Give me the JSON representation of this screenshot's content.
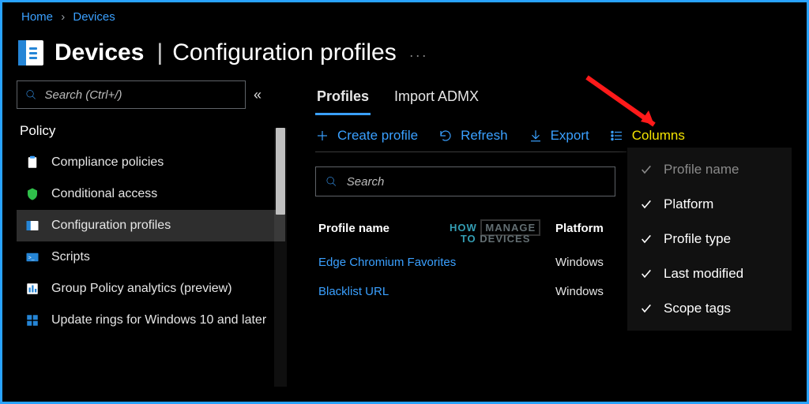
{
  "breadcrumb": {
    "home": "Home",
    "devices": "Devices"
  },
  "title": {
    "strong": "Devices",
    "rest": "Configuration profiles"
  },
  "sidebar": {
    "search_placeholder": "Search (Ctrl+/)",
    "section": "Policy",
    "items": [
      {
        "label": "Compliance policies"
      },
      {
        "label": "Conditional access"
      },
      {
        "label": "Configuration profiles"
      },
      {
        "label": "Scripts"
      },
      {
        "label": "Group Policy analytics (preview)"
      },
      {
        "label": "Update rings for Windows 10 and later"
      }
    ]
  },
  "tabs": {
    "profiles": "Profiles",
    "import": "Import ADMX"
  },
  "toolbar": {
    "create": "Create profile",
    "refresh": "Refresh",
    "export": "Export",
    "columns": "Columns"
  },
  "main_search_placeholder": "Search",
  "columns_menu": [
    {
      "label": "Profile name",
      "disabled": true
    },
    {
      "label": "Platform",
      "disabled": false
    },
    {
      "label": "Profile type",
      "disabled": false
    },
    {
      "label": "Last modified",
      "disabled": false
    },
    {
      "label": "Scope tags",
      "disabled": false
    }
  ],
  "table": {
    "headers": {
      "name": "Profile name",
      "platform": "Platform"
    },
    "rows": [
      {
        "name": "Edge Chromium Favorites",
        "platform": "Windows"
      },
      {
        "name": "Blacklist URL",
        "platform": "Windows"
      }
    ]
  },
  "watermark": {
    "l1": "HOW",
    "l2": "MANAGE",
    "l3": "TO",
    "l4": "DEVICES"
  }
}
